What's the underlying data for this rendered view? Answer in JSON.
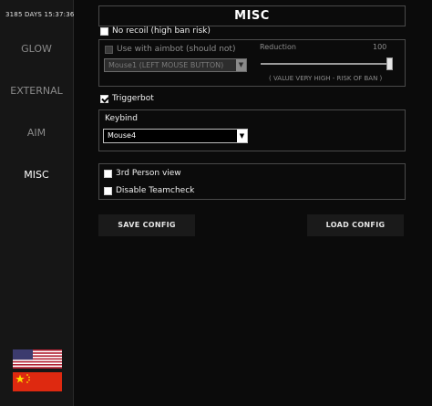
{
  "sidebar": {
    "uptime": "3185 DAYS  15:37:36",
    "nav": [
      {
        "label": "GLOW",
        "active": false
      },
      {
        "label": "EXTERNAL",
        "active": false
      },
      {
        "label": "AIM",
        "active": false
      },
      {
        "label": "MISC",
        "active": true
      }
    ],
    "flags": [
      "us-flag-icon",
      "china-flag-icon"
    ]
  },
  "main": {
    "title": "MISC",
    "no_recoil": {
      "label": "No recoil (high ban risk)",
      "checked": false
    },
    "use_with_aimbot": {
      "label": "Use with aimbot (should not)",
      "checked": false,
      "disabled": true
    },
    "recoil_key_select": {
      "value": "Mouse1 (LEFT MOUSE BUTTON)",
      "disabled": true
    },
    "reduction": {
      "label": "Reduction",
      "value": "100",
      "value_fraction": 1.0,
      "warning": "( VALUE VERY HIGH - RISK OF BAN )"
    },
    "triggerbot": {
      "label": "Triggerbot",
      "checked": true
    },
    "keybind": {
      "label": "Keybind",
      "value": "Mouse4"
    },
    "third_person": {
      "label": "3rd Person view",
      "checked": false
    },
    "disable_teamcheck": {
      "label": "Disable Teamcheck",
      "checked": false
    },
    "save_config": "SAVE CONFIG",
    "load_config": "LOAD CONFIG"
  },
  "colors": {
    "background": "#0b0b0b",
    "sidebar": "#161616",
    "border": "#4a4a4a",
    "button": "#1a1a1a",
    "inactive_nav": "#8a8a8a"
  }
}
